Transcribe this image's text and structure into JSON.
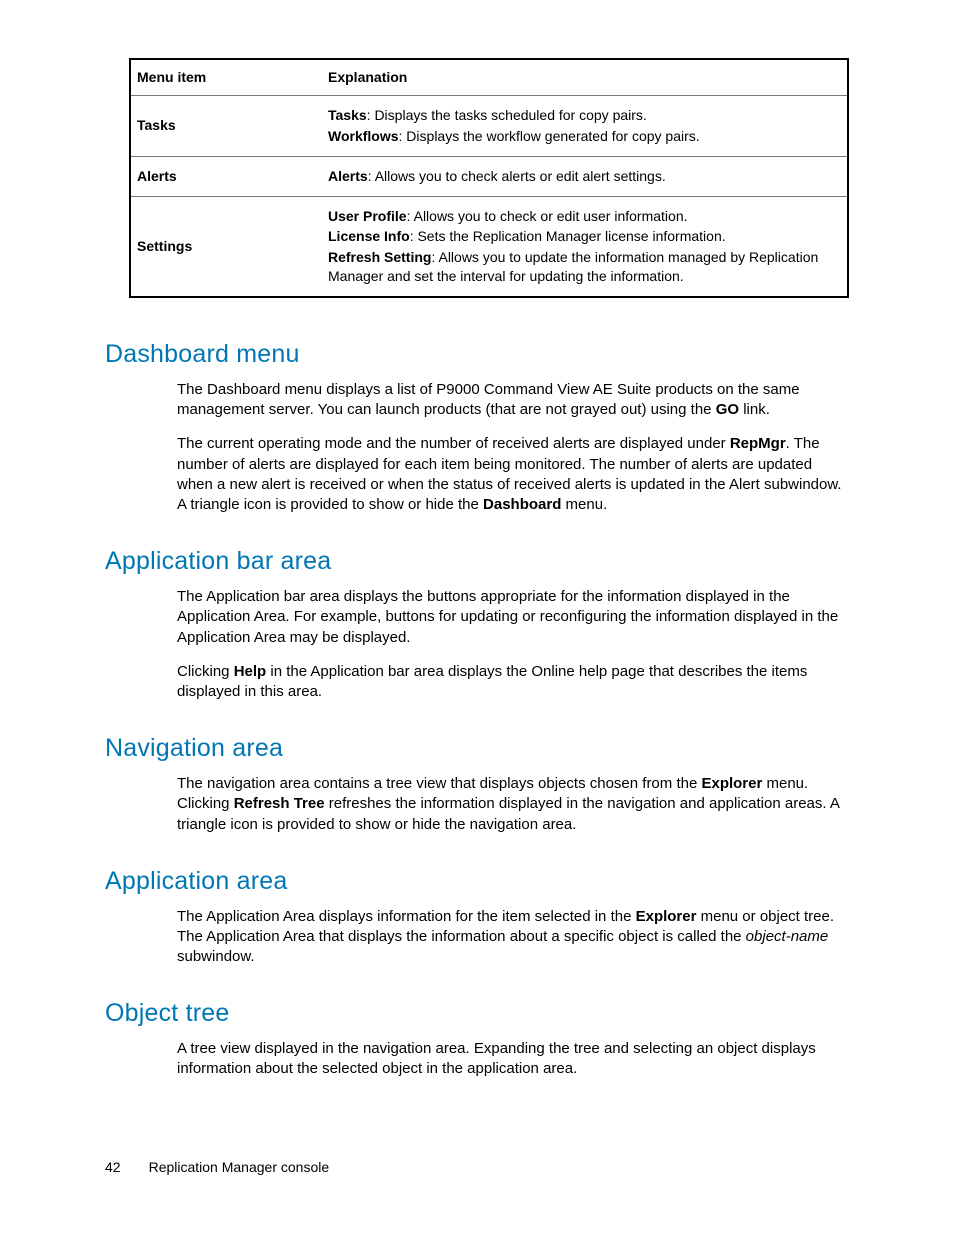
{
  "table": {
    "headers": [
      "Menu item",
      "Explanation"
    ],
    "rows": [
      {
        "item": "Tasks",
        "lines": [
          {
            "bold": "Tasks",
            "text": ": Displays the tasks scheduled for copy pairs."
          },
          {
            "bold": "Workflows",
            "text": ": Displays the workflow generated for copy pairs."
          }
        ]
      },
      {
        "item": "Alerts",
        "lines": [
          {
            "bold": "Alerts",
            "text": ": Allows you to check alerts or edit alert settings."
          }
        ]
      },
      {
        "item": "Settings",
        "lines": [
          {
            "bold": "User Profile",
            "text": ": Allows you to check or edit user information."
          },
          {
            "bold": "License Info",
            "text": ": Sets the Replication Manager license information."
          },
          {
            "bold": "Refresh Setting",
            "text": ": Allows you to update the information managed by Replication Manager and set the interval for updating the information."
          }
        ]
      }
    ]
  },
  "sections": {
    "dashboard": {
      "title": "Dashboard menu",
      "p1a": "The Dashboard menu displays a list of P9000 Command View AE Suite products on the same management server.  You can launch products (that are not grayed out) using the ",
      "p1b": "GO",
      "p1c": " link.",
      "p2a": "The current operating mode and the number of received alerts are displayed under ",
      "p2b": "RepMgr",
      "p2c": ". The number of alerts are displayed for each item being monitored. The number of alerts are updated when a new alert is received or when the status of received alerts is updated in the Alert subwindow. A triangle icon is provided to show or hide the ",
      "p2d": "Dashboard",
      "p2e": " menu."
    },
    "appbar": {
      "title": "Application bar area",
      "p1": "The Application bar area displays the buttons appropriate for the information displayed in the Application Area. For example, buttons for updating or reconfiguring the information displayed in the Application Area may be displayed.",
      "p2a": "Clicking ",
      "p2b": "Help",
      "p2c": " in the Application bar area displays the Online help page that describes the items displayed in this area."
    },
    "nav": {
      "title": "Navigation area",
      "p1a": "The navigation area contains a tree view that displays objects chosen from the ",
      "p1b": "Explorer",
      "p1c": " menu. Clicking ",
      "p1d": "Refresh Tree",
      "p1e": " refreshes the information displayed in the navigation and application areas. A triangle icon is provided to show or hide the navigation area."
    },
    "apparea": {
      "title": "Application area",
      "p1a": "The Application Area displays information for the item selected in the ",
      "p1b": "Explorer",
      "p1c": " menu or object tree. The Application Area that displays the information about a specific object is called the ",
      "p1d": "object-name",
      "p1e": " subwindow."
    },
    "tree": {
      "title": "Object tree",
      "p1": "A tree view displayed in the navigation area.  Expanding the tree and selecting an object displays information about the selected object in the application area."
    }
  },
  "footer": {
    "page": "42",
    "title": "Replication Manager console"
  }
}
